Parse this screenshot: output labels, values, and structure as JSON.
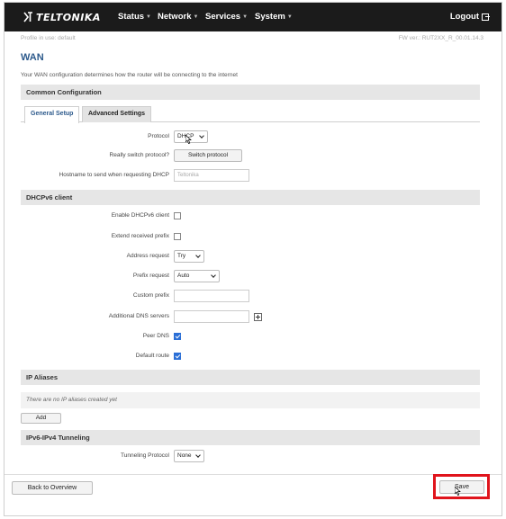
{
  "brand": {
    "name": "TELTONIKA"
  },
  "nav": {
    "items": [
      {
        "label": "Status"
      },
      {
        "label": "Network"
      },
      {
        "label": "Services"
      },
      {
        "label": "System"
      }
    ],
    "logout_label": "Logout"
  },
  "subbar": {
    "profile": "Profile in use: default",
    "firmware": "FW ver.: RUT2XX_R_00.01.14.3"
  },
  "page": {
    "title": "WAN",
    "description": "Your WAN configuration determines how the router will be connecting to the internet"
  },
  "common": {
    "heading": "Common Configuration",
    "tabs": [
      {
        "label": "General Setup",
        "active": true
      },
      {
        "label": "Advanced Settings",
        "active": false
      }
    ],
    "protocol_label": "Protocol",
    "protocol_value": "DHCP",
    "switch_label": "Really switch protocol?",
    "switch_button": "Switch protocol",
    "hostname_label": "Hostname to send when requesting DHCP",
    "hostname_placeholder": "Teltonika"
  },
  "dhcpv6": {
    "heading": "DHCPv6 client",
    "enable_label": "Enable DHCPv6 client",
    "enable_checked": false,
    "extend_label": "Extend received prefix",
    "extend_checked": false,
    "address_label": "Address request",
    "address_value": "Try",
    "prefix_label": "Prefix request",
    "prefix_value": "Auto",
    "custom_prefix_label": "Custom prefix",
    "custom_prefix_value": "",
    "dns_label": "Additional DNS servers",
    "dns_value": "",
    "peer_dns_label": "Peer DNS",
    "peer_dns_checked": true,
    "default_route_label": "Default route",
    "default_route_checked": true
  },
  "aliases": {
    "heading": "IP Aliases",
    "empty_text": "There are no IP aliases created yet",
    "add_button": "Add"
  },
  "tunneling": {
    "heading": "IPv6-IPv4 Tunneling",
    "protocol_label": "Tunneling Protocol",
    "protocol_value": "None"
  },
  "footer": {
    "back_button": "Back to Overview",
    "save_button": "Save"
  },
  "colors": {
    "navbar": "#1b1b1b",
    "accent": "#2d5a8c",
    "checkbox": "#2b6fd6",
    "highlight": "#e0141c"
  }
}
